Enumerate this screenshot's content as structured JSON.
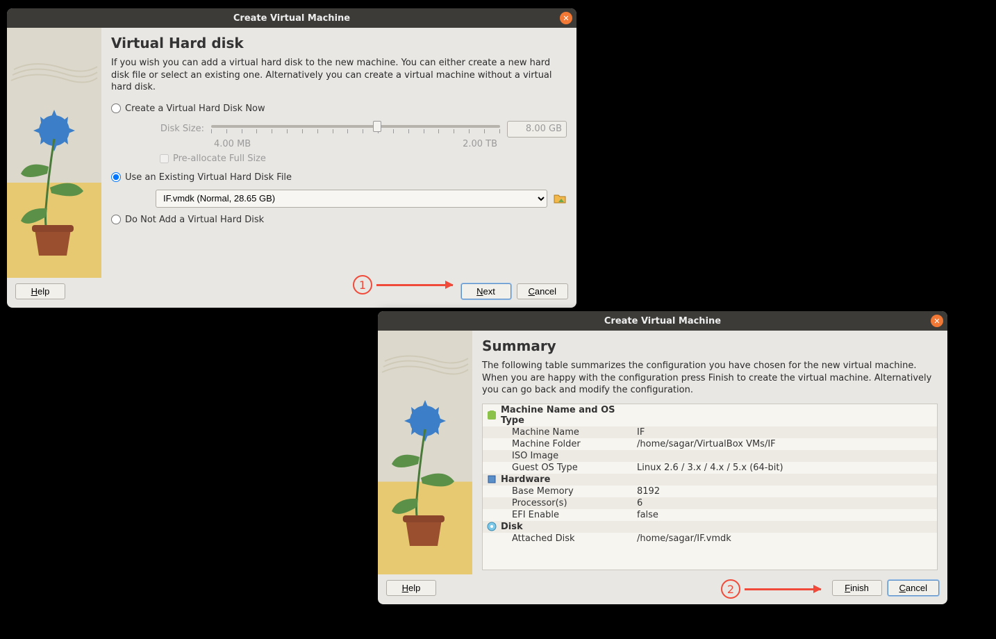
{
  "dialog1": {
    "title": "Create Virtual Machine",
    "heading": "Virtual Hard disk",
    "desc": "If you wish you can add a virtual hard disk to the new machine. You can either create a new hard disk file or select an existing one. Alternatively you can create a virtual machine without a virtual hard disk.",
    "radio_create": "Create a Virtual Hard Disk Now",
    "disk_size_label": "Disk Size:",
    "size_value": "8.00 GB",
    "scale_min": "4.00 MB",
    "scale_max": "2.00 TB",
    "prealloc": "Pre-allocate Full Size",
    "radio_existing": "Use an Existing Virtual Hard Disk File",
    "existing_file": "IF.vmdk (Normal, 28.65 GB)",
    "radio_none": "Do Not Add a Virtual Hard Disk",
    "help": "Help",
    "next": "Next",
    "cancel": "Cancel"
  },
  "dialog2": {
    "title": "Create Virtual Machine",
    "heading": "Summary",
    "desc": "The following table summarizes the configuration you have chosen for the new virtual machine. When you are happy with the configuration press Finish to create the virtual machine. Alternatively you can go back and modify the configuration.",
    "sec1": "Machine Name and OS Type",
    "r1l": "Machine Name",
    "r1v": "IF",
    "r2l": "Machine Folder",
    "r2v": "/home/sagar/VirtualBox VMs/IF",
    "r3l": "ISO Image",
    "r3v": "",
    "r4l": "Guest OS Type",
    "r4v": "Linux 2.6 / 3.x / 4.x / 5.x (64-bit)",
    "sec2": "Hardware",
    "r5l": "Base Memory",
    "r5v": "8192",
    "r6l": "Processor(s)",
    "r6v": "6",
    "r7l": "EFI Enable",
    "r7v": "false",
    "sec3": "Disk",
    "r8l": "Attached Disk",
    "r8v": "/home/sagar/IF.vmdk",
    "help": "Help",
    "finish": "Finish",
    "cancel": "Cancel"
  },
  "anno1": "1",
  "anno2": "2"
}
